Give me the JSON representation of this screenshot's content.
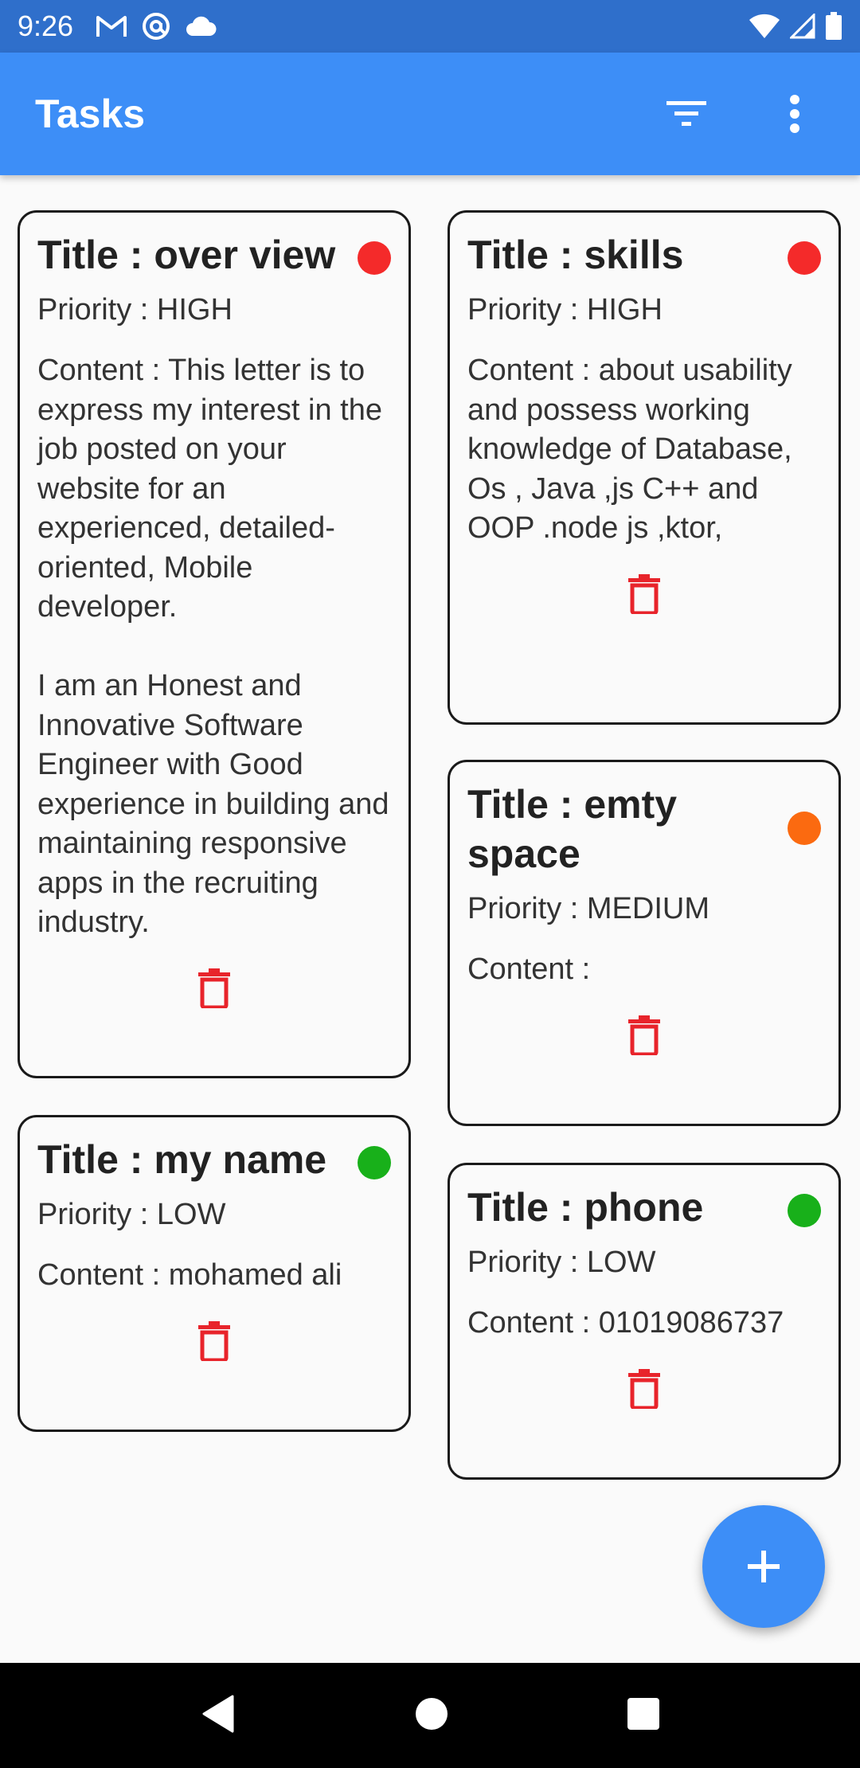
{
  "status_bar": {
    "time": "9:26",
    "notification_icons": [
      "gmail-icon",
      "at-sign-icon",
      "cloud-icon"
    ],
    "system_icons": [
      "wifi-icon",
      "signal-icon",
      "battery-icon"
    ]
  },
  "app_bar": {
    "title": "Tasks",
    "actions": [
      "filter-icon",
      "more-vert-icon"
    ]
  },
  "colors": {
    "primary": "#3d8ef7",
    "status_bar": "#2f6fcb",
    "high": "#f42a2a",
    "medium": "#fb6a10",
    "low": "#18b01a",
    "delete": "#e8242b"
  },
  "tasks": [
    {
      "title": "Title : over view",
      "priority": "Priority : HIGH",
      "content": "Content : This letter is to express my interest in the job posted on your website for an experienced, detailed-oriented, Mobile developer.\n\nI am an Honest and Innovative Software Engineer with Good experience in building and maintaining responsive apps in the recruiting industry.",
      "priority_color": "#f42a2a"
    },
    {
      "title": "Title : skills",
      "priority": "Priority : HIGH",
      "content": "Content : about usability and possess working knowledge of Database, Os , Java ,js C++ and OOP .node js ,ktor,\n",
      "priority_color": "#f42a2a"
    },
    {
      "title": "Title : emty space",
      "priority": "Priority : MEDIUM",
      "content": "Content :",
      "priority_color": "#fb6a10"
    },
    {
      "title": "Title : my name",
      "priority": "Priority : LOW",
      "content": "Content : mohamed ali",
      "priority_color": "#18b01a"
    },
    {
      "title": "Title : phone",
      "priority": "Priority : LOW",
      "content": "Content : 01019086737",
      "priority_color": "#18b01a"
    }
  ],
  "fab": {
    "icon": "plus-icon"
  },
  "nav_bar": {
    "buttons": [
      "back-icon",
      "home-icon",
      "recents-icon"
    ]
  }
}
